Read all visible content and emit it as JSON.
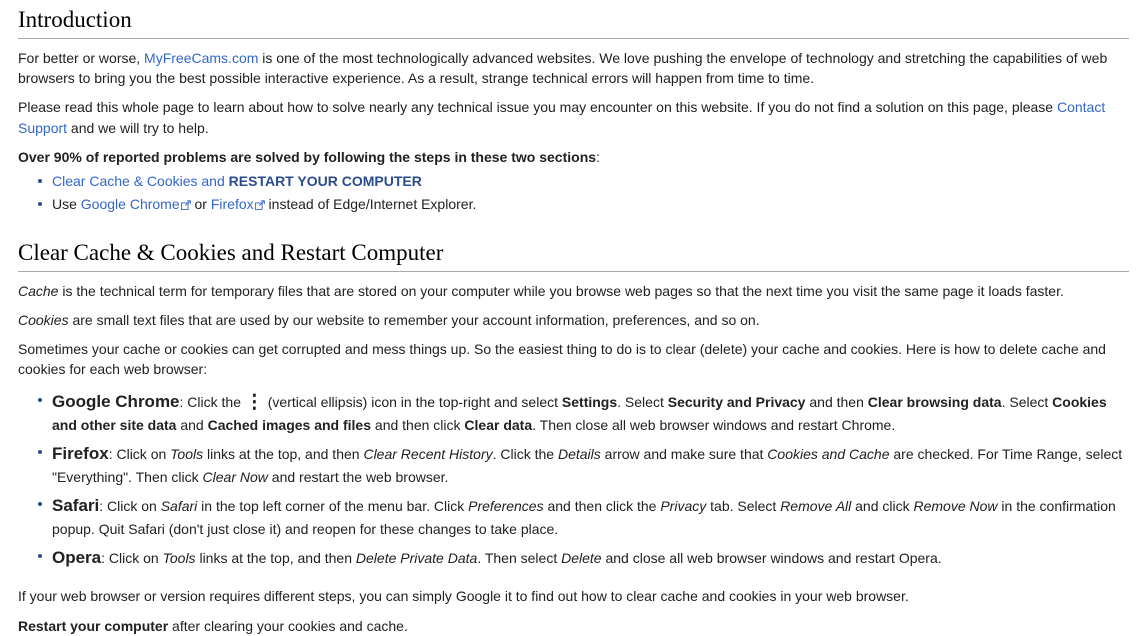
{
  "colors": {
    "link": "#3366cc",
    "strong_link": "#2a4b8d",
    "text": "#202122",
    "heading_rule": "#a2a9b1"
  },
  "sections": {
    "introduction": {
      "heading": "Introduction",
      "paragraph1": {
        "pre_link": "For better or worse, ",
        "link": "MyFreeCams.com",
        "post_link": " is one of the most technologically advanced websites. We love pushing the envelope of technology and stretching the capabilities of web browsers to bring you the best possible interactive experience. As a result, strange technical errors will happen from time to time."
      },
      "paragraph2": {
        "pre_link": "Please read this whole page to learn about how to solve nearly any technical issue you may encounter on this website. If you do not find a solution on this page, please ",
        "link": "Contact Support",
        "post_link": " and we will try to help."
      },
      "callout": "Over 90% of reported problems are solved by following the steps in these two sections",
      "callout_suffix": ":",
      "bullets": [
        {
          "link_text": "Clear Cache & Cookies and ",
          "link_strong": "RESTART YOUR COMPUTER"
        },
        {
          "prefix": "Use ",
          "link1": "Google Chrome",
          "middle": " or ",
          "link2": "Firefox",
          "suffix": " instead of Edge/Internet Explorer."
        }
      ]
    },
    "clear_cache": {
      "heading": "Clear Cache & Cookies and Restart Computer",
      "paragraph_cache": {
        "italic": "Cache",
        "rest": " is the technical term for temporary files that are stored on your computer while you browse web pages so that the next time you visit the same page it loads faster."
      },
      "paragraph_cookies": {
        "italic": "Cookies",
        "rest": " are small text files that are used by our website to remember your account information, preferences, and so on."
      },
      "paragraph_intro": "Sometimes your cache or cookies can get corrupted and mess things up. So the easiest thing to do is to clear (delete) your cache and cookies. Here is how to delete cache and cookies for each web browser:",
      "browsers": [
        {
          "name": "Google Chrome",
          "colon": ": ",
          "t1": "Click the ",
          "icon": "⋮",
          "icon_name": "vertical-ellipsis-icon",
          "t2": " (vertical ellipsis) icon in the top-right and select ",
          "b1": "Settings",
          "t3": ". Select ",
          "b2": "Security and Privacy",
          "t4": " and then ",
          "b3": "Clear browsing data",
          "t5": ". Select ",
          "b4": "Cookies and other site data",
          "t6": " and ",
          "b5": "Cached images and files",
          "t7": " and then click ",
          "b6": "Clear data",
          "t8": ". Then close all web browser windows and restart Chrome."
        },
        {
          "name": "Firefox",
          "colon": ": ",
          "t1": "Click on ",
          "i1": "Tools",
          "t2": " links at the top, and then ",
          "i2": "Clear Recent History",
          "t3": ". Click the ",
          "i3": "Details",
          "t4": " arrow and make sure that ",
          "i4": "Cookies and Cache",
          "t5": " are checked. For Time Range, select \"Everything\". Then click ",
          "i5": "Clear Now",
          "t6": " and restart the web browser."
        },
        {
          "name": "Safari",
          "colon": ": ",
          "t1": "Click on ",
          "i1": "Safari",
          "t2": " in the top left corner of the menu bar. Click ",
          "i2": "Preferences",
          "t3": " and then click the ",
          "i3": "Privacy",
          "t4": " tab. Select ",
          "i4": "Remove All",
          "t5": " and click ",
          "i5": "Remove Now",
          "t6": " in the confirmation popup. Quit Safari (don't just close it) and reopen for these changes to take place."
        },
        {
          "name": "Opera",
          "colon": ": ",
          "t1": "Click on ",
          "i1": "Tools",
          "t2": " links at the top, and then ",
          "i2": "Delete Private Data",
          "t3": ". Then select ",
          "i3": "Delete",
          "t4": " and close all web browser windows and restart Opera."
        }
      ],
      "closing_paragraph": "If your web browser or version requires different steps, you can simply Google it to find out how to clear cache and cookies in your web browser.",
      "restart_note": {
        "bold": "Restart your computer",
        "rest": " after clearing your cookies and cache."
      }
    }
  }
}
